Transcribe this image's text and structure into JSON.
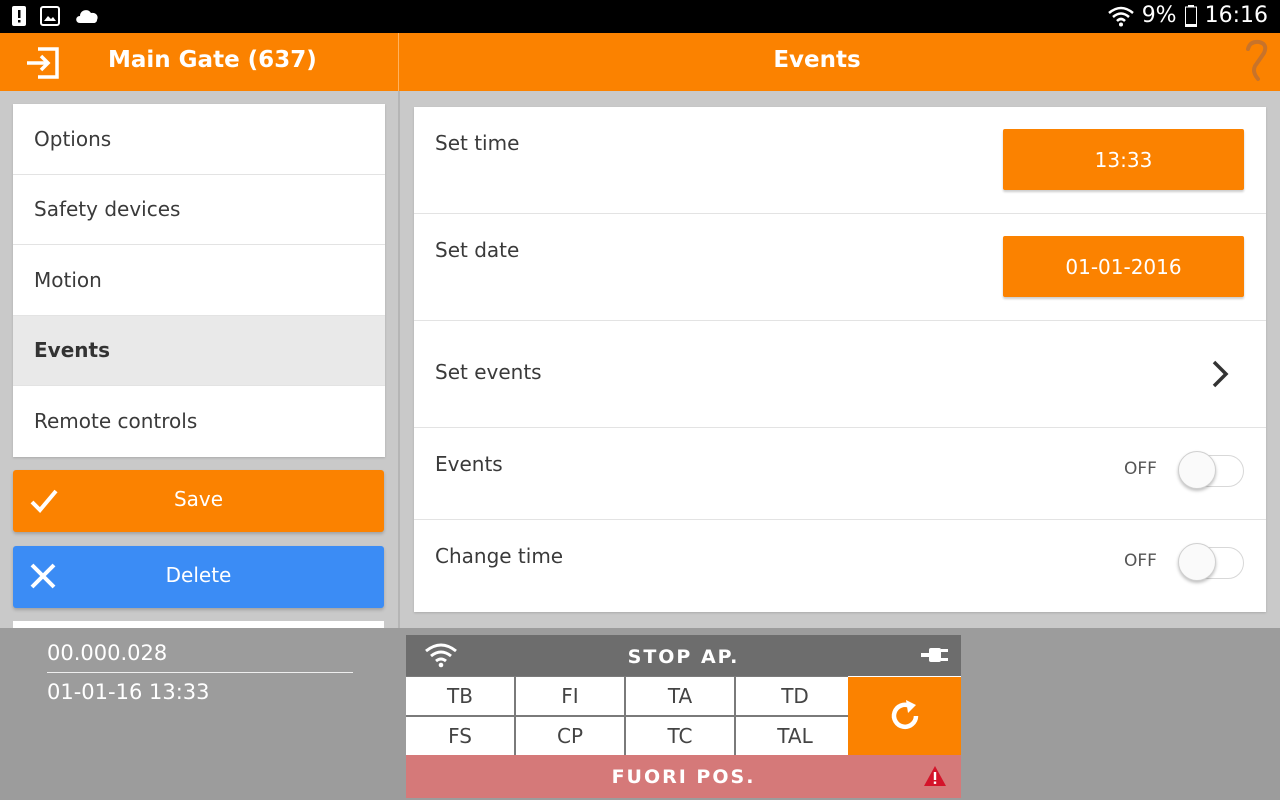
{
  "status_bar": {
    "icons": [
      "alert-icon",
      "image-icon",
      "cloud-icon",
      "wifi-icon",
      "battery-icon"
    ],
    "battery": "9%",
    "time": "16:16"
  },
  "header": {
    "left_title": "Main Gate (637)",
    "center_title": "Events",
    "accent_color": "#fb8200"
  },
  "sidebar": {
    "items": [
      {
        "label": "Options"
      },
      {
        "label": "Safety devices"
      },
      {
        "label": "Motion"
      },
      {
        "label": "Events"
      },
      {
        "label": "Remote controls"
      }
    ],
    "active": "Events",
    "save_label": "Save",
    "delete_label": "Delete",
    "delete_color": "#3b8cf5"
  },
  "settings": {
    "set_time": {
      "label": "Set time",
      "value": "13:33"
    },
    "set_date": {
      "label": "Set date",
      "value": "01-01-2016"
    },
    "set_events": {
      "label": "Set events"
    },
    "events": {
      "label": "Events",
      "state": "OFF"
    },
    "change_time": {
      "label": "Change time",
      "state": "OFF"
    }
  },
  "bottom": {
    "counter": "00.000.028",
    "datetime": "01-01-16 13:33",
    "panel": {
      "status_title": "STOP AP.",
      "cells": [
        "TB",
        "FI",
        "TA",
        "TD",
        "FS",
        "CP",
        "TC",
        "TAL"
      ],
      "footer_title": "FUORI POS.",
      "footer_color": "#d57979"
    }
  }
}
